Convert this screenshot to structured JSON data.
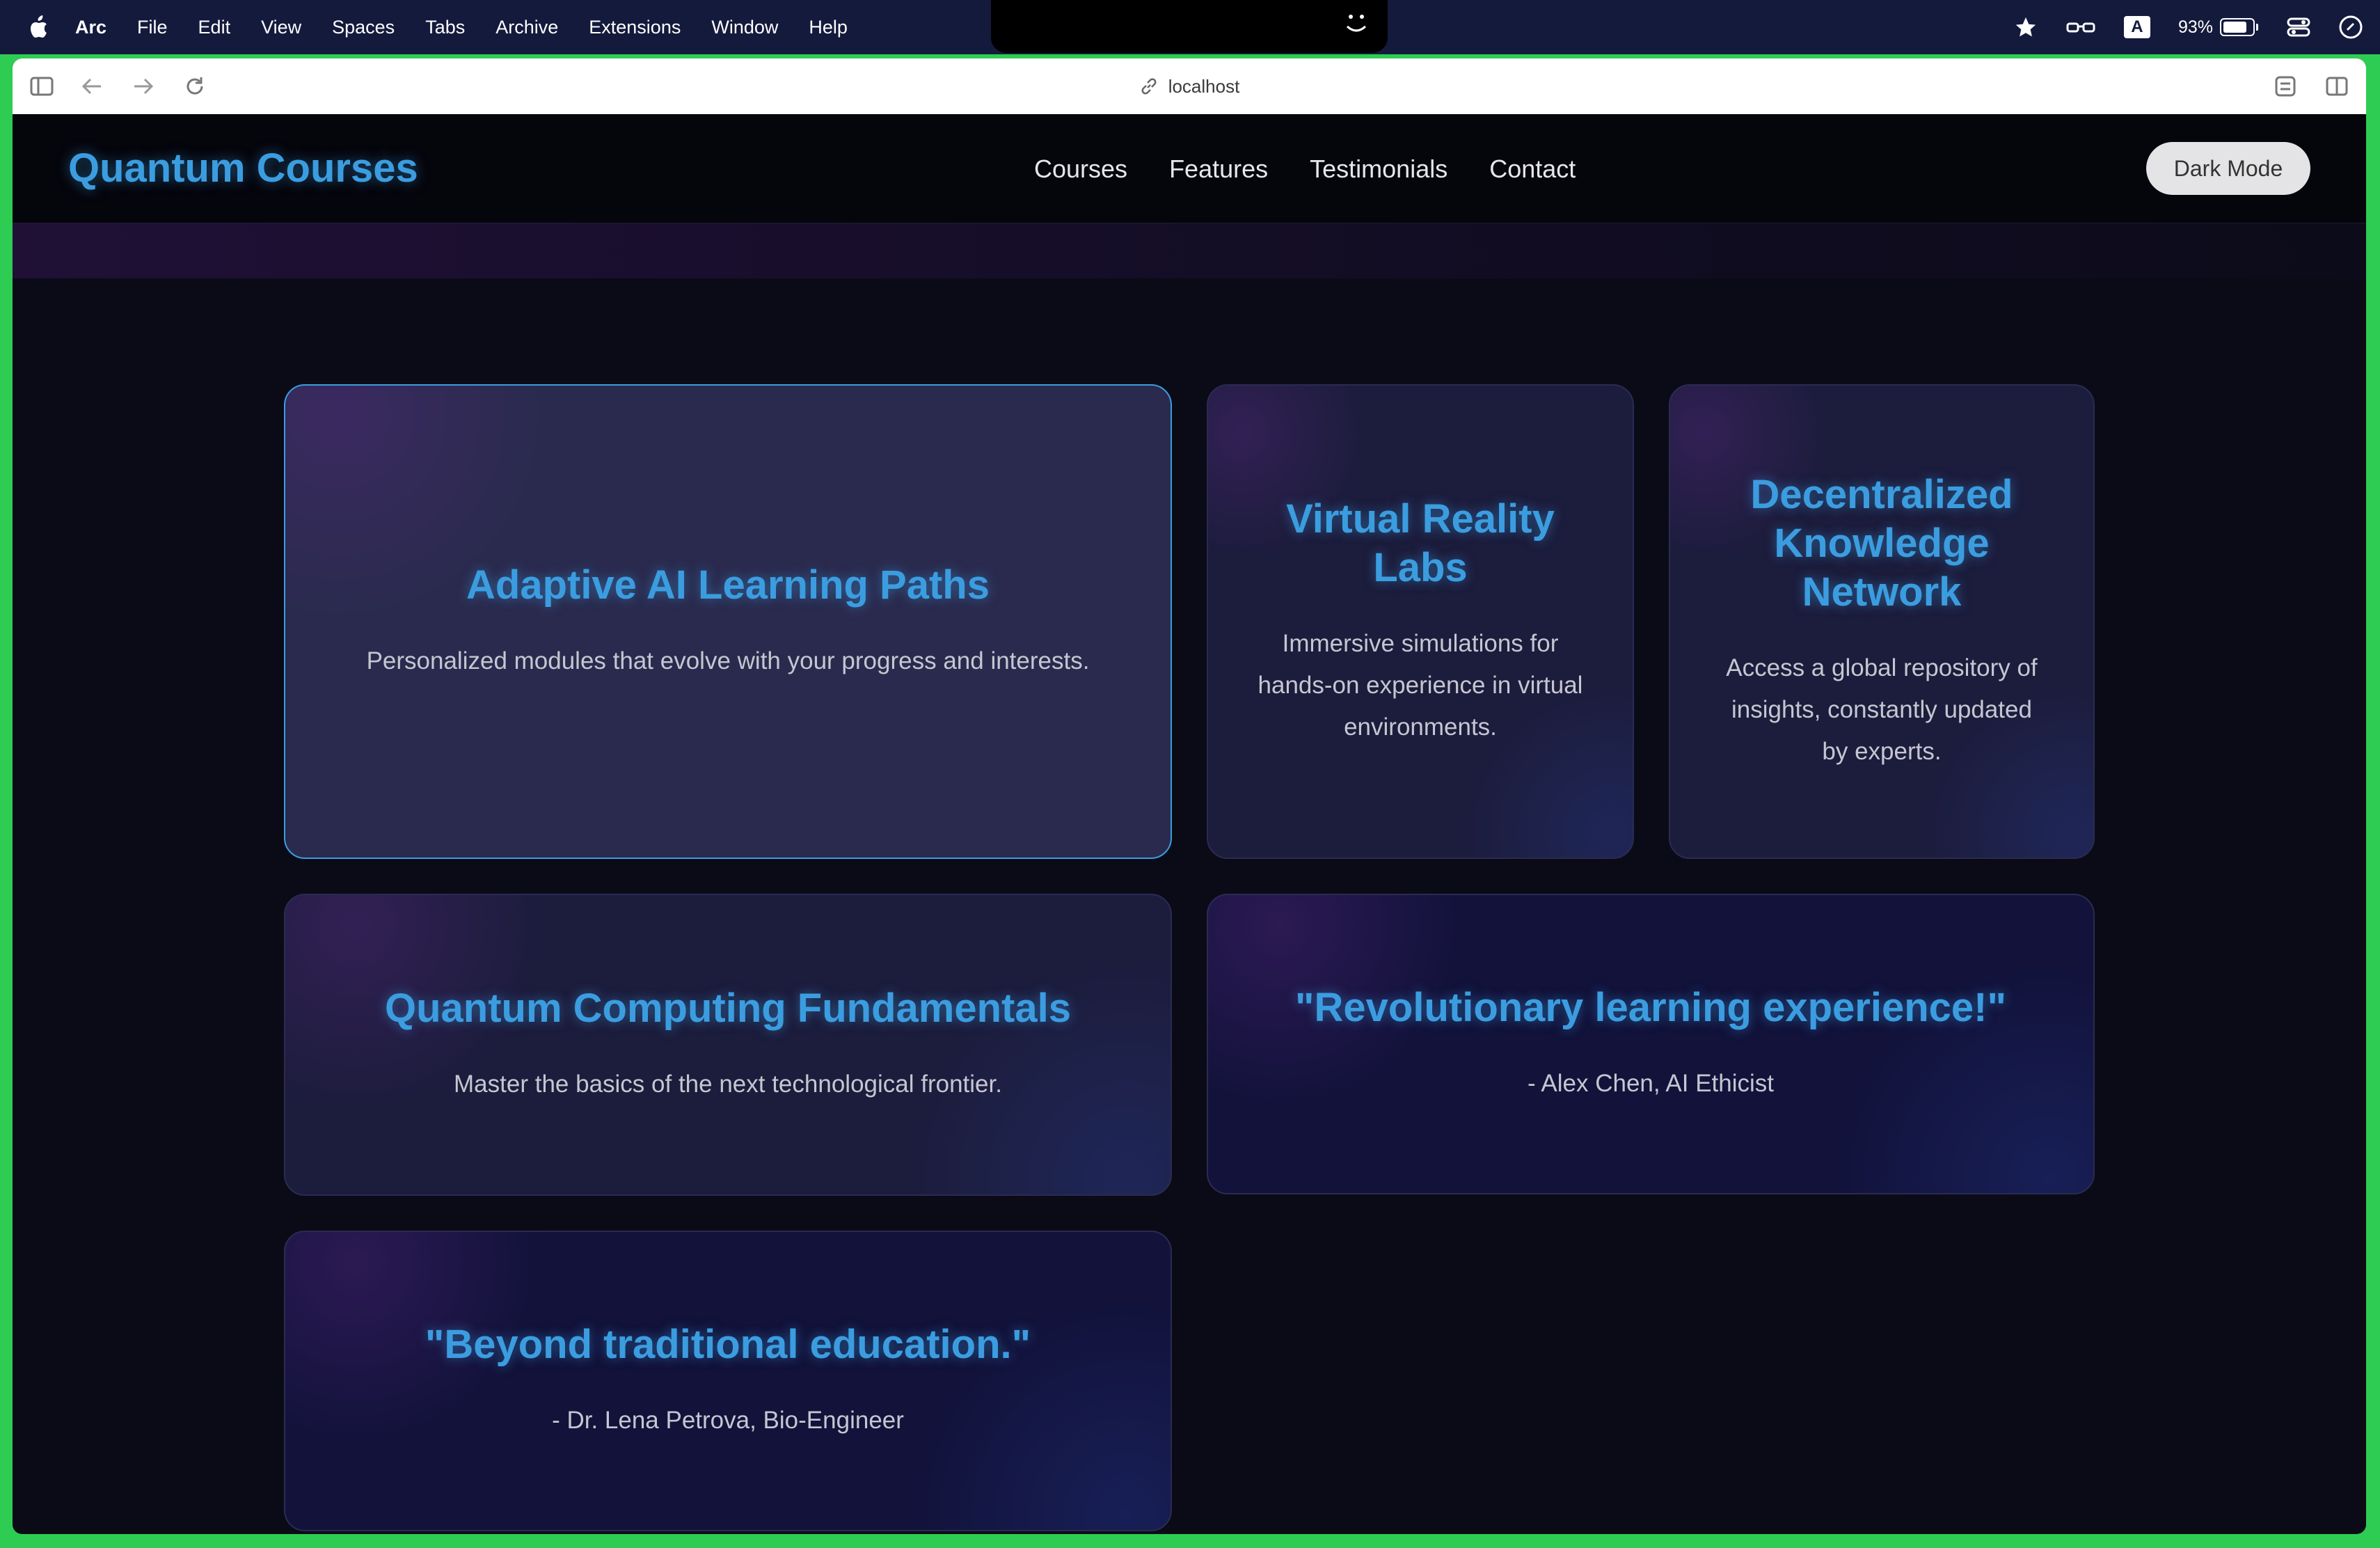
{
  "menubar": {
    "app": "Arc",
    "items": [
      "File",
      "Edit",
      "View",
      "Spaces",
      "Tabs",
      "Archive",
      "Extensions",
      "Window",
      "Help"
    ],
    "battery": "93%",
    "battery_level": 0.93,
    "badge": "A"
  },
  "browser": {
    "url": "localhost"
  },
  "site": {
    "logo": "Quantum Courses",
    "nav": [
      "Courses",
      "Features",
      "Testimonials",
      "Contact"
    ],
    "mode_button": "Dark Mode",
    "accent": "#3b9de0",
    "cards": [
      {
        "title": "Adaptive AI Learning Paths",
        "text": "Personalized modules that evolve with your progress and interests."
      },
      {
        "title": "Virtual Reality Labs",
        "text": "Immersive simulations for hands-on experience in virtual environments."
      },
      {
        "title": "Decentralized Knowledge Network",
        "text": "Access a global repository of insights, constantly updated by experts."
      },
      {
        "title": "Quantum Computing Fundamentals",
        "text": "Master the basics of the next technological frontier."
      },
      {
        "title": "\"Revolutionary learning experience!\"",
        "text": "- Alex Chen, AI Ethicist"
      },
      {
        "title": "\"Beyond traditional education.\"",
        "text": "- Dr. Lena Petrova, Bio-Engineer"
      }
    ]
  }
}
